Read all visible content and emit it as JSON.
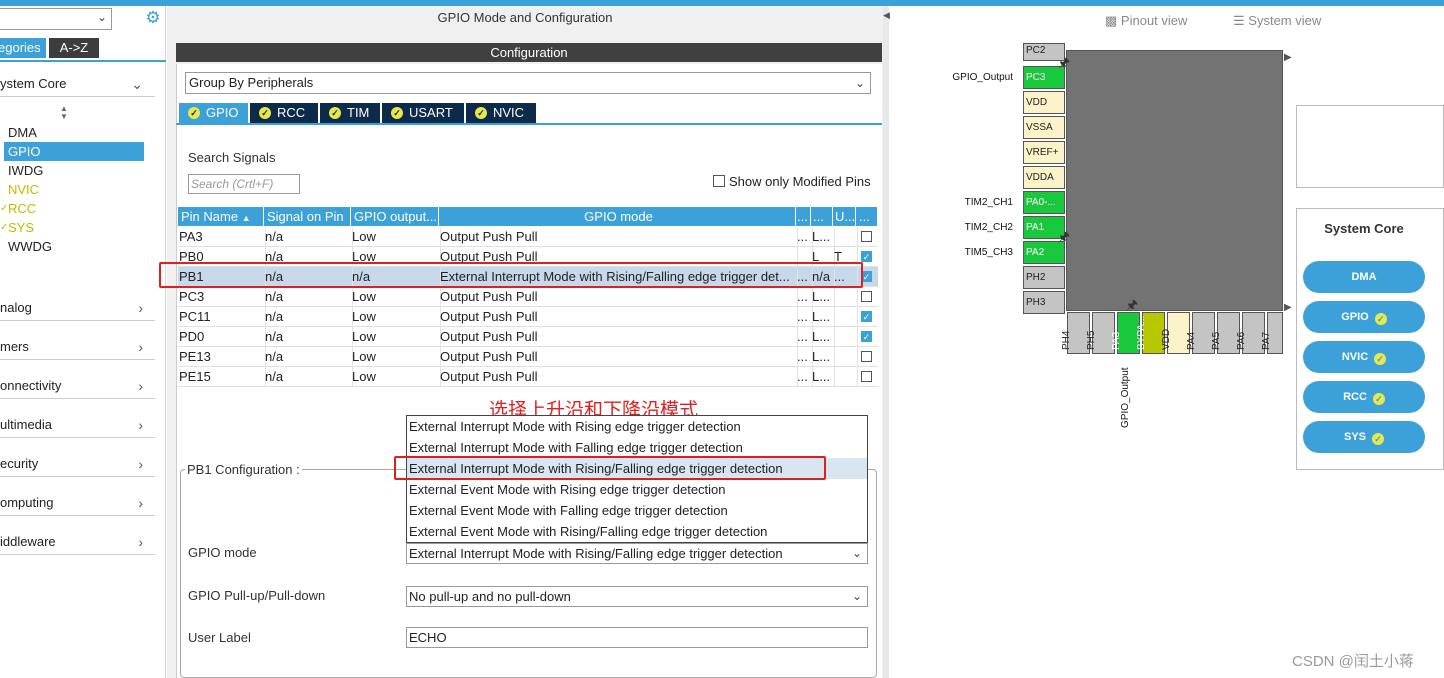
{
  "left": {
    "tabs": {
      "categories": "egories",
      "az": "A->Z"
    },
    "system_core": "ystem Core",
    "sub_items": [
      "DMA",
      "GPIO",
      "IWDG",
      "NVIC",
      "RCC",
      "SYS",
      "WWDG"
    ],
    "categories": [
      "nalog",
      "mers",
      "onnectivity",
      "ultimedia",
      "ecurity",
      "omputing",
      "iddleware"
    ]
  },
  "center": {
    "title": "GPIO Mode and Configuration",
    "config_bar": "Configuration",
    "group_by": "Group By Peripherals",
    "tabs": [
      "GPIO",
      "RCC",
      "TIM",
      "USART",
      "NVIC"
    ],
    "search_label": "Search Signals",
    "search_placeholder": "Search (Crtl+F)",
    "show_modified": "Show only Modified Pins",
    "headers": [
      "Pin Name",
      "Signal on Pin",
      "GPIO output...",
      "GPIO mode",
      "...",
      "...",
      "U...",
      "..."
    ],
    "rows": [
      {
        "pin": "PA3",
        "signal": "n/a",
        "output": "Low",
        "mode": "Output Push Pull",
        "c1": "...",
        "c2": "L...",
        "c3": "",
        "checked": false
      },
      {
        "pin": "PB0",
        "signal": "n/a",
        "output": "Low",
        "mode": "Output Push Pull",
        "c1": "",
        "c2": "L",
        "c3": "T",
        "checked": true
      },
      {
        "pin": "PB1",
        "signal": "n/a",
        "output": "n/a",
        "mode": "External Interrupt Mode with Rising/Falling edge trigger det...",
        "c1": "...",
        "c2": "n/a",
        "c3": "...",
        "checked": true
      },
      {
        "pin": "PC3",
        "signal": "n/a",
        "output": "Low",
        "mode": "Output Push Pull",
        "c1": "...",
        "c2": "L...",
        "c3": "",
        "checked": false
      },
      {
        "pin": "PC11",
        "signal": "n/a",
        "output": "Low",
        "mode": "Output Push Pull",
        "c1": "...",
        "c2": "L...",
        "c3": "",
        "checked": true
      },
      {
        "pin": "PD0",
        "signal": "n/a",
        "output": "Low",
        "mode": "Output Push Pull",
        "c1": "...",
        "c2": "L...",
        "c3": "",
        "checked": true
      },
      {
        "pin": "PE13",
        "signal": "n/a",
        "output": "Low",
        "mode": "Output Push Pull",
        "c1": "...",
        "c2": "L...",
        "c3": "",
        "checked": false
      },
      {
        "pin": "PE15",
        "signal": "n/a",
        "output": "Low",
        "mode": "Output Push Pull",
        "c1": "...",
        "c2": "L...",
        "c3": "",
        "checked": false
      }
    ],
    "annotation": "选择上升沿和下降沿模式",
    "popup_items": [
      "External Interrupt Mode with Rising edge trigger detection",
      "External Interrupt Mode with Falling edge trigger detection",
      "External Interrupt Mode with Rising/Falling edge trigger detection",
      "External Event Mode with Rising edge trigger detection",
      "External Event Mode with Falling edge trigger detection",
      "External Event Mode with Rising/Falling edge trigger detection"
    ],
    "pb1_config": "PB1 Configuration :",
    "fields": {
      "gpio_mode_label": "GPIO mode",
      "gpio_mode_value": "External Interrupt Mode with Rising/Falling edge trigger detection",
      "pull_label": "GPIO Pull-up/Pull-down",
      "pull_value": "No pull-up and no pull-down",
      "user_label": "User Label",
      "user_value": "ECHO"
    }
  },
  "right": {
    "pinout_view": "Pinout view",
    "system_view": "System view",
    "left_pins": [
      "PC2",
      "PC3",
      "VDD",
      "VSSA",
      "VREF+",
      "VDDA",
      "PA0-...",
      "PA1",
      "PA2",
      "PH2",
      "PH3"
    ],
    "signals": {
      "pc3": "GPIO_Output",
      "pa0": "TIM2_CH1",
      "pa1": "TIM2_CH2",
      "pa2": "TIM5_CH3"
    },
    "bottom_pins": [
      "PH4",
      "PH5",
      "PA3",
      "BYPA...",
      "VDD",
      "PA4",
      "PA5",
      "PA6",
      "PA7"
    ],
    "bottom_signal": "GPIO_Output",
    "system_core_title": "System Core",
    "core_buttons": [
      {
        "label": "DMA",
        "ok": false
      },
      {
        "label": "GPIO",
        "ok": true
      },
      {
        "label": "NVIC",
        "ok": true
      },
      {
        "label": "RCC",
        "ok": true
      },
      {
        "label": "SYS",
        "ok": true
      }
    ],
    "watermark": "CSDN @闰土小蒋"
  }
}
